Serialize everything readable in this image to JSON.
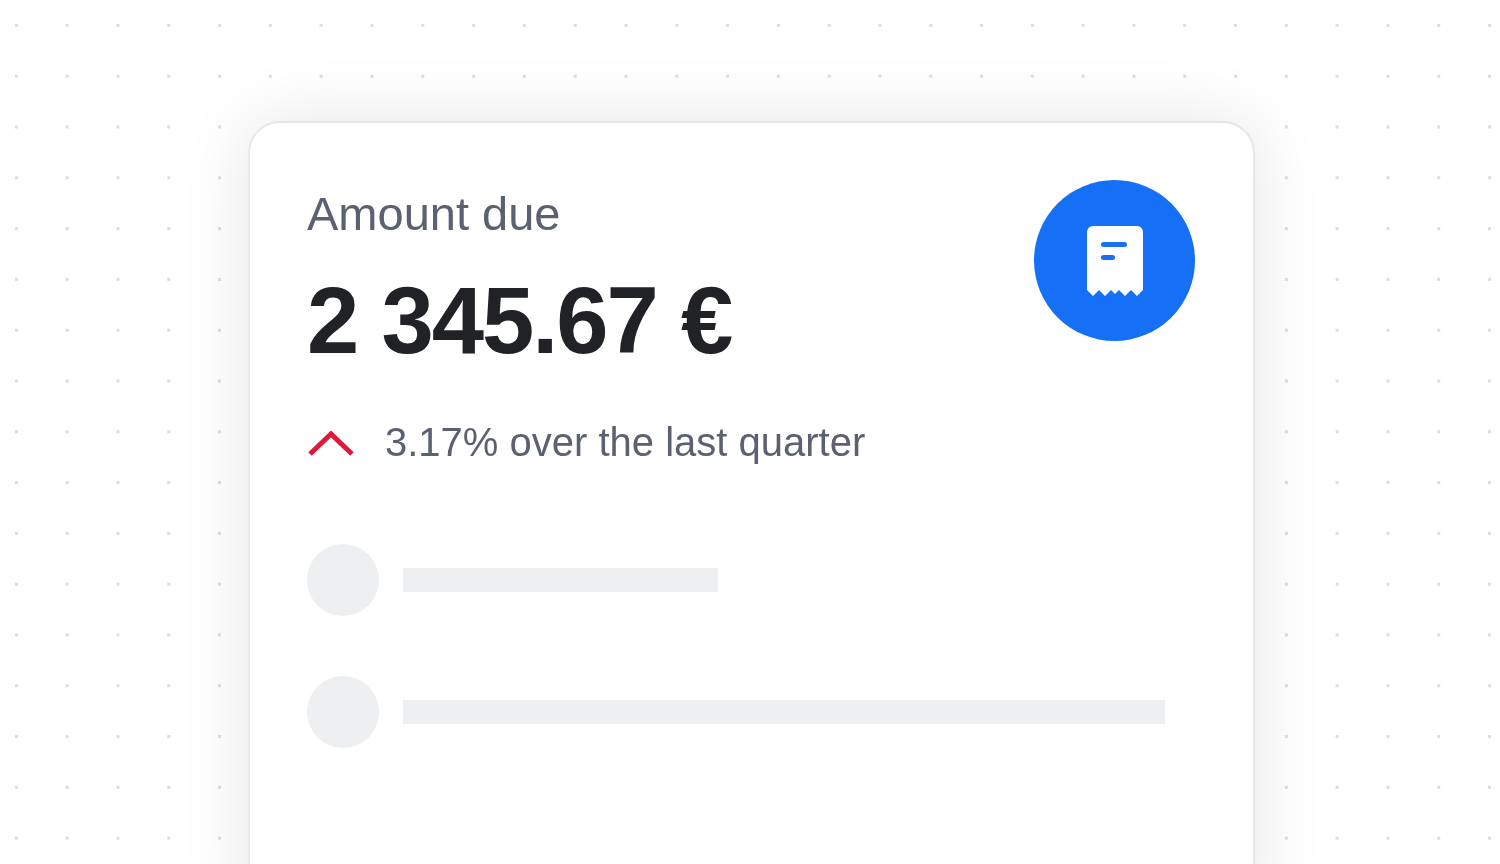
{
  "card": {
    "label": "Amount due",
    "amount": "2 345.67 €",
    "trend": {
      "increase": true,
      "text": "3.17% over the last quarter"
    },
    "placeholder_rows": [
      {
        "kind": "short"
      },
      {
        "kind": "long"
      }
    ]
  }
}
